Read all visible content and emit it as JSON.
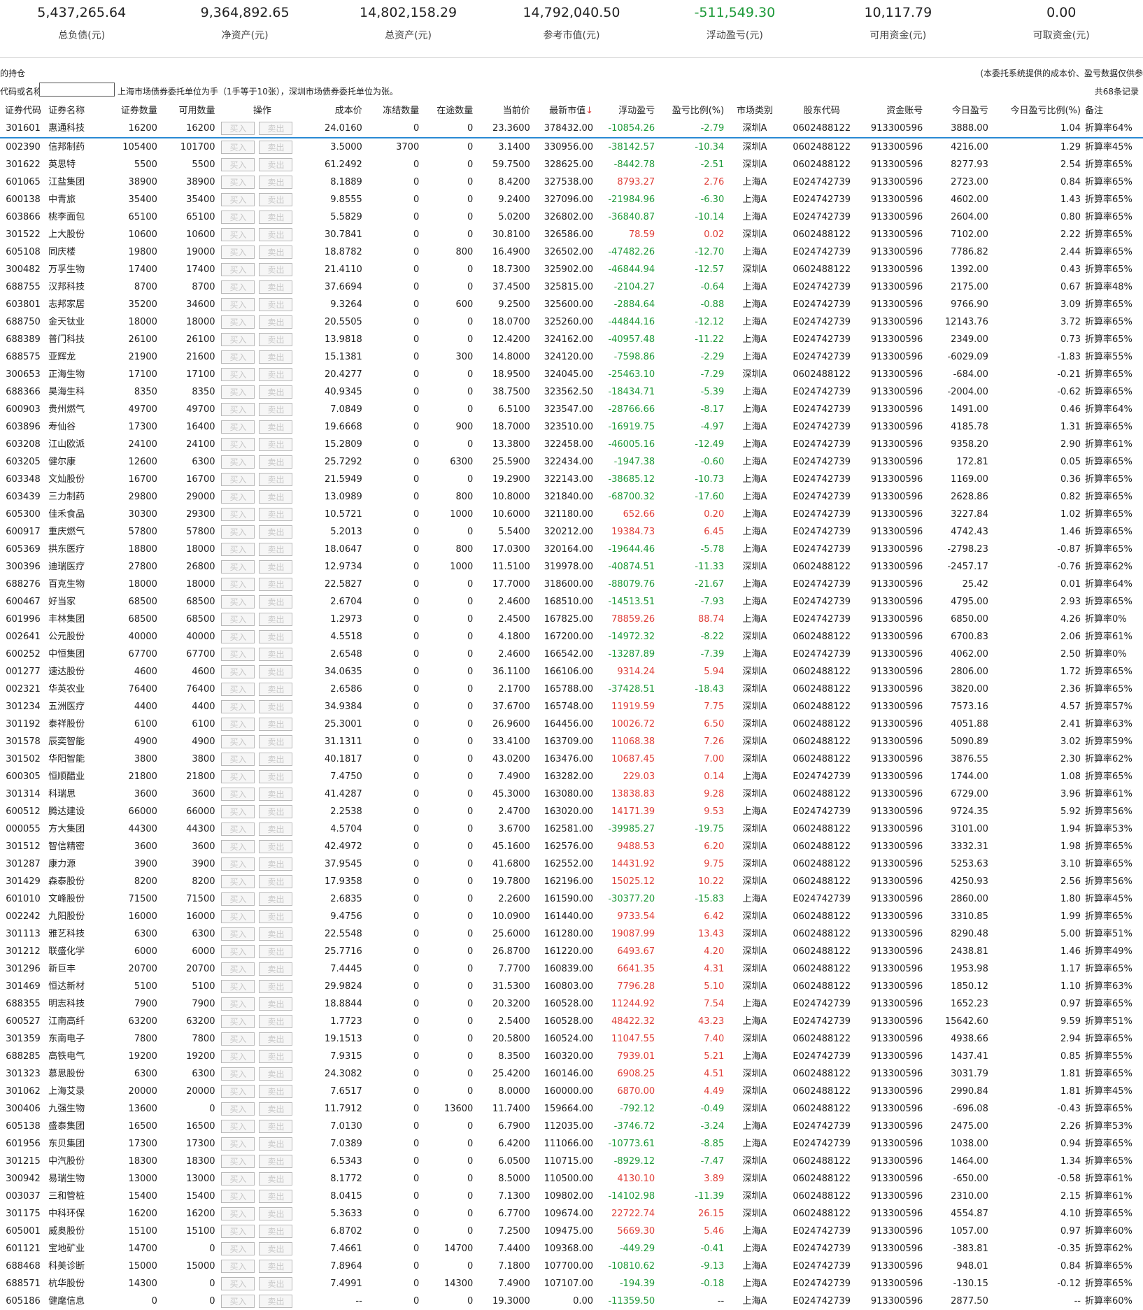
{
  "summary": [
    {
      "value": "5,437,265.64",
      "label": "总负债(元)"
    },
    {
      "value": "9,364,892.65",
      "label": "净资产(元)"
    },
    {
      "value": "14,802,158.29",
      "label": "总资产(元)"
    },
    {
      "value": "14,792,040.50",
      "label": "参考市值(元)"
    },
    {
      "value": "-511,549.30",
      "label": "浮动盈亏(元)"
    },
    {
      "value": "10,117.79",
      "label": "可用资金(元)"
    },
    {
      "value": "0.00",
      "label": "可取资金(元)"
    }
  ],
  "info_bar": {
    "left_text": "的持仓",
    "right_text": "(本委托系统提供的成本价、盈亏数据仅供参"
  },
  "search": {
    "label": "代码或名称",
    "value": "",
    "hint": "上海市场债券委托单位为手（1手等于10张），深圳市场债券委托单位为张。",
    "record_count": "共68条记录"
  },
  "buttons": {
    "buy": "买入",
    "sell": "卖出"
  },
  "columns": [
    "证券代码",
    "证券名称",
    "证券数量",
    "可用数量",
    "操作",
    "成本价",
    "冻结数量",
    "在途数量",
    "当前价",
    "最新市值",
    "浮动盈亏",
    "盈亏比例(%)",
    "市场类别",
    "股东代码",
    "资金账号",
    "今日盈亏",
    "今日盈亏比例(%)",
    "备注"
  ],
  "sort_arrow": "↓",
  "rows": [
    [
      "301601",
      "惠通科技",
      "16200",
      "16200",
      "24.0160",
      "0",
      "0",
      "23.3600",
      "378432.00",
      "-10854.26",
      "-2.79",
      "深圳A",
      "0602488122",
      "913300596",
      "3888.00",
      "1.04",
      "折算率64%"
    ],
    [
      "002390",
      "信邦制药",
      "105400",
      "101700",
      "3.5000",
      "3700",
      "0",
      "3.1400",
      "330956.00",
      "-38142.57",
      "-10.34",
      "深圳A",
      "0602488122",
      "913300596",
      "4216.00",
      "1.29",
      "折算率45%"
    ],
    [
      "301622",
      "英思特",
      "5500",
      "5500",
      "61.2492",
      "0",
      "0",
      "59.7500",
      "328625.00",
      "-8442.78",
      "-2.51",
      "深圳A",
      "0602488122",
      "913300596",
      "8277.93",
      "2.54",
      "折算率65%"
    ],
    [
      "601065",
      "江盐集团",
      "38900",
      "38900",
      "8.1889",
      "0",
      "0",
      "8.4200",
      "327538.00",
      "8793.27",
      "2.76",
      "上海A",
      "E024742739",
      "913300596",
      "2723.00",
      "0.84",
      "折算率65%"
    ],
    [
      "600138",
      "中青旅",
      "35400",
      "35400",
      "9.8555",
      "0",
      "0",
      "9.2400",
      "327096.00",
      "-21984.96",
      "-6.30",
      "上海A",
      "E024742739",
      "913300596",
      "4602.00",
      "1.43",
      "折算率65%"
    ],
    [
      "603866",
      "桃李面包",
      "65100",
      "65100",
      "5.5829",
      "0",
      "0",
      "5.0200",
      "326802.00",
      "-36840.87",
      "-10.14",
      "上海A",
      "E024742739",
      "913300596",
      "2604.00",
      "0.80",
      "折算率65%"
    ],
    [
      "301522",
      "上大股份",
      "10600",
      "10600",
      "30.7841",
      "0",
      "0",
      "30.8100",
      "326586.00",
      "78.59",
      "0.02",
      "深圳A",
      "0602488122",
      "913300596",
      "7102.00",
      "2.22",
      "折算率65%"
    ],
    [
      "605108",
      "同庆楼",
      "19800",
      "19000",
      "18.8782",
      "0",
      "800",
      "16.4900",
      "326502.00",
      "-47482.26",
      "-12.70",
      "上海A",
      "E024742739",
      "913300596",
      "7786.82",
      "2.44",
      "折算率65%"
    ],
    [
      "300482",
      "万孚生物",
      "17400",
      "17400",
      "21.4110",
      "0",
      "0",
      "18.7300",
      "325902.00",
      "-46844.94",
      "-12.57",
      "深圳A",
      "0602488122",
      "913300596",
      "1392.00",
      "0.43",
      "折算率65%"
    ],
    [
      "688755",
      "汉邦科技",
      "8700",
      "8700",
      "37.6694",
      "0",
      "0",
      "37.4500",
      "325815.00",
      "-2104.27",
      "-0.64",
      "上海A",
      "E024742739",
      "913300596",
      "2175.00",
      "0.67",
      "折算率48%"
    ],
    [
      "603801",
      "志邦家居",
      "35200",
      "34600",
      "9.3264",
      "0",
      "600",
      "9.2500",
      "325600.00",
      "-2884.64",
      "-0.88",
      "上海A",
      "E024742739",
      "913300596",
      "9766.90",
      "3.09",
      "折算率65%"
    ],
    [
      "688750",
      "金天钛业",
      "18000",
      "18000",
      "20.5505",
      "0",
      "0",
      "18.0700",
      "325260.00",
      "-44844.16",
      "-12.12",
      "上海A",
      "E024742739",
      "913300596",
      "12143.76",
      "3.72",
      "折算率65%"
    ],
    [
      "688389",
      "普门科技",
      "26100",
      "26100",
      "13.9818",
      "0",
      "0",
      "12.4200",
      "324162.00",
      "-40957.48",
      "-11.22",
      "上海A",
      "E024742739",
      "913300596",
      "2349.00",
      "0.73",
      "折算率65%"
    ],
    [
      "688575",
      "亚辉龙",
      "21900",
      "21600",
      "15.1381",
      "0",
      "300",
      "14.8000",
      "324120.00",
      "-7598.86",
      "-2.29",
      "上海A",
      "E024742739",
      "913300596",
      "-6029.09",
      "-1.83",
      "折算率55%"
    ],
    [
      "300653",
      "正海生物",
      "17100",
      "17100",
      "20.4277",
      "0",
      "0",
      "18.9500",
      "324045.00",
      "-25463.10",
      "-7.29",
      "深圳A",
      "0602488122",
      "913300596",
      "-684.00",
      "-0.21",
      "折算率65%"
    ],
    [
      "688366",
      "昊海生科",
      "8350",
      "8350",
      "40.9345",
      "0",
      "0",
      "38.7500",
      "323562.50",
      "-18434.71",
      "-5.39",
      "上海A",
      "E024742739",
      "913300596",
      "-2004.00",
      "-0.62",
      "折算率65%"
    ],
    [
      "600903",
      "贵州燃气",
      "49700",
      "49700",
      "7.0849",
      "0",
      "0",
      "6.5100",
      "323547.00",
      "-28766.66",
      "-8.17",
      "上海A",
      "E024742739",
      "913300596",
      "1491.00",
      "0.46",
      "折算率64%"
    ],
    [
      "603896",
      "寿仙谷",
      "17300",
      "16400",
      "19.6668",
      "0",
      "900",
      "18.7000",
      "323510.00",
      "-16919.75",
      "-4.97",
      "上海A",
      "E024742739",
      "913300596",
      "4185.78",
      "1.31",
      "折算率65%"
    ],
    [
      "603208",
      "江山欧派",
      "24100",
      "24100",
      "15.2809",
      "0",
      "0",
      "13.3800",
      "322458.00",
      "-46005.16",
      "-12.49",
      "上海A",
      "E024742739",
      "913300596",
      "9358.20",
      "2.90",
      "折算率61%"
    ],
    [
      "603205",
      "健尔康",
      "12600",
      "6300",
      "25.7292",
      "0",
      "6300",
      "25.5900",
      "322434.00",
      "-1947.38",
      "-0.60",
      "上海A",
      "E024742739",
      "913300596",
      "172.81",
      "0.05",
      "折算率65%"
    ],
    [
      "603348",
      "文灿股份",
      "16700",
      "16700",
      "21.5949",
      "0",
      "0",
      "19.2900",
      "322143.00",
      "-38685.12",
      "-10.73",
      "上海A",
      "E024742739",
      "913300596",
      "1169.00",
      "0.36",
      "折算率65%"
    ],
    [
      "603439",
      "三力制药",
      "29800",
      "29000",
      "13.0989",
      "0",
      "800",
      "10.8000",
      "321840.00",
      "-68700.32",
      "-17.60",
      "上海A",
      "E024742739",
      "913300596",
      "2628.86",
      "0.82",
      "折算率65%"
    ],
    [
      "605300",
      "佳禾食品",
      "30300",
      "29300",
      "10.5721",
      "0",
      "1000",
      "10.6000",
      "321180.00",
      "652.66",
      "0.20",
      "上海A",
      "E024742739",
      "913300596",
      "3227.84",
      "1.02",
      "折算率65%"
    ],
    [
      "600917",
      "重庆燃气",
      "57800",
      "57800",
      "5.2013",
      "0",
      "0",
      "5.5400",
      "320212.00",
      "19384.73",
      "6.45",
      "上海A",
      "E024742739",
      "913300596",
      "4742.43",
      "1.46",
      "折算率65%"
    ],
    [
      "605369",
      "拱东医疗",
      "18800",
      "18000",
      "18.0647",
      "0",
      "800",
      "17.0300",
      "320164.00",
      "-19644.46",
      "-5.78",
      "上海A",
      "E024742739",
      "913300596",
      "-2798.23",
      "-0.87",
      "折算率65%"
    ],
    [
      "300396",
      "迪瑞医疗",
      "27800",
      "26800",
      "12.9734",
      "0",
      "1000",
      "11.5100",
      "319978.00",
      "-40874.51",
      "-11.33",
      "深圳A",
      "0602488122",
      "913300596",
      "-2457.17",
      "-0.76",
      "折算率62%"
    ],
    [
      "688276",
      "百克生物",
      "18000",
      "18000",
      "22.5827",
      "0",
      "0",
      "17.7000",
      "318600.00",
      "-88079.76",
      "-21.67",
      "上海A",
      "E024742739",
      "913300596",
      "25.42",
      "0.01",
      "折算率64%"
    ],
    [
      "600467",
      "好当家",
      "68500",
      "68500",
      "2.6704",
      "0",
      "0",
      "2.4600",
      "168510.00",
      "-14513.51",
      "-7.93",
      "上海A",
      "E024742739",
      "913300596",
      "4795.00",
      "2.93",
      "折算率65%"
    ],
    [
      "601996",
      "丰林集团",
      "68500",
      "68500",
      "1.2973",
      "0",
      "0",
      "2.4500",
      "167825.00",
      "78859.26",
      "88.74",
      "上海A",
      "E024742739",
      "913300596",
      "6850.00",
      "4.26",
      "折算率0%"
    ],
    [
      "002641",
      "公元股份",
      "40000",
      "40000",
      "4.5518",
      "0",
      "0",
      "4.1800",
      "167200.00",
      "-14972.32",
      "-8.22",
      "深圳A",
      "0602488122",
      "913300596",
      "6700.83",
      "2.06",
      "折算率61%"
    ],
    [
      "600252",
      "中恒集团",
      "67700",
      "67700",
      "2.6548",
      "0",
      "0",
      "2.4600",
      "166542.00",
      "-13287.89",
      "-7.39",
      "上海A",
      "E024742739",
      "913300596",
      "4062.00",
      "2.50",
      "折算率0%"
    ],
    [
      "001277",
      "速达股份",
      "4600",
      "4600",
      "34.0635",
      "0",
      "0",
      "36.1100",
      "166106.00",
      "9314.24",
      "5.94",
      "深圳A",
      "0602488122",
      "913300596",
      "2806.00",
      "1.72",
      "折算率65%"
    ],
    [
      "002321",
      "华英农业",
      "76400",
      "76400",
      "2.6586",
      "0",
      "0",
      "2.1700",
      "165788.00",
      "-37428.51",
      "-18.43",
      "深圳A",
      "0602488122",
      "913300596",
      "3820.00",
      "2.36",
      "折算率65%"
    ],
    [
      "301234",
      "五洲医疗",
      "4400",
      "4400",
      "34.9384",
      "0",
      "0",
      "37.6700",
      "165748.00",
      "11919.59",
      "7.75",
      "深圳A",
      "0602488122",
      "913300596",
      "7573.16",
      "4.57",
      "折算率57%"
    ],
    [
      "301192",
      "泰祥股份",
      "6100",
      "6100",
      "25.3001",
      "0",
      "0",
      "26.9600",
      "164456.00",
      "10026.72",
      "6.50",
      "深圳A",
      "0602488122",
      "913300596",
      "4051.88",
      "2.41",
      "折算率63%"
    ],
    [
      "301578",
      "辰奕智能",
      "4900",
      "4900",
      "31.1311",
      "0",
      "0",
      "33.4100",
      "163709.00",
      "11068.38",
      "7.26",
      "深圳A",
      "0602488122",
      "913300596",
      "5090.89",
      "3.02",
      "折算率59%"
    ],
    [
      "301502",
      "华阳智能",
      "3800",
      "3800",
      "40.1817",
      "0",
      "0",
      "43.0200",
      "163476.00",
      "10687.45",
      "7.00",
      "深圳A",
      "0602488122",
      "913300596",
      "3876.55",
      "2.30",
      "折算率62%"
    ],
    [
      "600305",
      "恒顺醋业",
      "21800",
      "21800",
      "7.4750",
      "0",
      "0",
      "7.4900",
      "163282.00",
      "229.03",
      "0.14",
      "上海A",
      "E024742739",
      "913300596",
      "1744.00",
      "1.08",
      "折算率65%"
    ],
    [
      "301314",
      "科瑞思",
      "3600",
      "3600",
      "41.4287",
      "0",
      "0",
      "45.3000",
      "163080.00",
      "13838.83",
      "9.28",
      "深圳A",
      "0602488122",
      "913300596",
      "6729.00",
      "3.96",
      "折算率61%"
    ],
    [
      "600512",
      "腾达建设",
      "66000",
      "66000",
      "2.2538",
      "0",
      "0",
      "2.4700",
      "163020.00",
      "14171.39",
      "9.53",
      "上海A",
      "E024742739",
      "913300596",
      "9724.35",
      "5.92",
      "折算率56%"
    ],
    [
      "000055",
      "方大集团",
      "44300",
      "44300",
      "4.5704",
      "0",
      "0",
      "3.6700",
      "162581.00",
      "-39985.27",
      "-19.75",
      "深圳A",
      "0602488122",
      "913300596",
      "3101.00",
      "1.94",
      "折算率53%"
    ],
    [
      "301512",
      "智信精密",
      "3600",
      "3600",
      "42.4972",
      "0",
      "0",
      "45.1600",
      "162576.00",
      "9488.53",
      "6.20",
      "深圳A",
      "0602488122",
      "913300596",
      "3332.31",
      "1.98",
      "折算率65%"
    ],
    [
      "301287",
      "康力源",
      "3900",
      "3900",
      "37.9545",
      "0",
      "0",
      "41.6800",
      "162552.00",
      "14431.92",
      "9.75",
      "深圳A",
      "0602488122",
      "913300596",
      "5253.63",
      "3.10",
      "折算率65%"
    ],
    [
      "301429",
      "森泰股份",
      "8200",
      "8200",
      "17.9358",
      "0",
      "0",
      "19.7800",
      "162196.00",
      "15025.12",
      "10.22",
      "深圳A",
      "0602488122",
      "913300596",
      "4250.93",
      "2.56",
      "折算率56%"
    ],
    [
      "601010",
      "文峰股份",
      "71500",
      "71500",
      "2.6835",
      "0",
      "0",
      "2.2600",
      "161590.00",
      "-30377.20",
      "-15.83",
      "上海A",
      "E024742739",
      "913300596",
      "2860.00",
      "1.80",
      "折算率45%"
    ],
    [
      "002242",
      "九阳股份",
      "16000",
      "16000",
      "9.4756",
      "0",
      "0",
      "10.0900",
      "161440.00",
      "9733.54",
      "6.42",
      "深圳A",
      "0602488122",
      "913300596",
      "3310.85",
      "1.99",
      "折算率65%"
    ],
    [
      "301113",
      "雅艺科技",
      "6300",
      "6300",
      "22.5548",
      "0",
      "0",
      "25.6000",
      "161280.00",
      "19087.99",
      "13.43",
      "深圳A",
      "0602488122",
      "913300596",
      "8290.48",
      "5.00",
      "折算率51%"
    ],
    [
      "301212",
      "联盛化学",
      "6000",
      "6000",
      "25.7716",
      "0",
      "0",
      "26.8700",
      "161220.00",
      "6493.67",
      "4.20",
      "深圳A",
      "0602488122",
      "913300596",
      "2438.81",
      "1.46",
      "折算率49%"
    ],
    [
      "301296",
      "新巨丰",
      "20700",
      "20700",
      "7.4445",
      "0",
      "0",
      "7.7700",
      "160839.00",
      "6641.35",
      "4.31",
      "深圳A",
      "0602488122",
      "913300596",
      "1953.98",
      "1.17",
      "折算率65%"
    ],
    [
      "301469",
      "恒达新材",
      "5100",
      "5100",
      "29.9824",
      "0",
      "0",
      "31.5300",
      "160803.00",
      "7796.28",
      "5.10",
      "深圳A",
      "0602488122",
      "913300596",
      "1850.12",
      "1.10",
      "折算率63%"
    ],
    [
      "688355",
      "明志科技",
      "7900",
      "7900",
      "18.8844",
      "0",
      "0",
      "20.3200",
      "160528.00",
      "11244.92",
      "7.54",
      "上海A",
      "E024742739",
      "913300596",
      "1652.23",
      "0.97",
      "折算率65%"
    ],
    [
      "600527",
      "江南高纤",
      "63200",
      "63200",
      "1.7723",
      "0",
      "0",
      "2.5400",
      "160528.00",
      "48422.32",
      "43.23",
      "上海A",
      "E024742739",
      "913300596",
      "15642.60",
      "9.59",
      "折算率51%"
    ],
    [
      "301359",
      "东南电子",
      "7800",
      "7800",
      "19.1513",
      "0",
      "0",
      "20.5800",
      "160524.00",
      "11047.55",
      "7.40",
      "深圳A",
      "0602488122",
      "913300596",
      "4938.66",
      "2.94",
      "折算率65%"
    ],
    [
      "688285",
      "高铁电气",
      "19200",
      "19200",
      "7.9315",
      "0",
      "0",
      "8.3500",
      "160320.00",
      "7939.01",
      "5.21",
      "上海A",
      "E024742739",
      "913300596",
      "1437.41",
      "0.85",
      "折算率55%"
    ],
    [
      "301323",
      "慕思股份",
      "6300",
      "6300",
      "24.3082",
      "0",
      "0",
      "25.4200",
      "160146.00",
      "6908.25",
      "4.51",
      "深圳A",
      "0602488122",
      "913300596",
      "3031.79",
      "1.81",
      "折算率65%"
    ],
    [
      "301062",
      "上海艾录",
      "20000",
      "20000",
      "7.6517",
      "0",
      "0",
      "8.0000",
      "160000.00",
      "6870.00",
      "4.49",
      "深圳A",
      "0602488122",
      "913300596",
      "2990.84",
      "1.81",
      "折算率45%"
    ],
    [
      "300406",
      "九强生物",
      "13600",
      "0",
      "11.7912",
      "0",
      "13600",
      "11.7400",
      "159664.00",
      "-792.12",
      "-0.49",
      "深圳A",
      "0602488122",
      "913300596",
      "-696.08",
      "-0.43",
      "折算率65%"
    ],
    [
      "605138",
      "盛泰集团",
      "16500",
      "16500",
      "7.0130",
      "0",
      "0",
      "6.7900",
      "112035.00",
      "-3746.72",
      "-3.24",
      "上海A",
      "E024742739",
      "913300596",
      "2475.00",
      "2.26",
      "折算率53%"
    ],
    [
      "601956",
      "东贝集团",
      "17300",
      "17300",
      "7.0389",
      "0",
      "0",
      "6.4200",
      "111066.00",
      "-10773.61",
      "-8.85",
      "上海A",
      "E024742739",
      "913300596",
      "1038.00",
      "0.94",
      "折算率65%"
    ],
    [
      "301215",
      "中汽股份",
      "18300",
      "18300",
      "6.5343",
      "0",
      "0",
      "6.0500",
      "110715.00",
      "-8929.12",
      "-7.47",
      "深圳A",
      "0602488122",
      "913300596",
      "1464.00",
      "1.34",
      "折算率65%"
    ],
    [
      "300942",
      "易瑞生物",
      "13000",
      "13000",
      "8.1772",
      "0",
      "0",
      "8.5000",
      "110500.00",
      "4130.10",
      "3.89",
      "深圳A",
      "0602488122",
      "913300596",
      "-650.00",
      "-0.58",
      "折算率61%"
    ],
    [
      "003037",
      "三和管桩",
      "15400",
      "15400",
      "8.0415",
      "0",
      "0",
      "7.1300",
      "109802.00",
      "-14102.98",
      "-11.39",
      "深圳A",
      "0602488122",
      "913300596",
      "2310.00",
      "2.15",
      "折算率61%"
    ],
    [
      "301175",
      "中科环保",
      "16200",
      "16200",
      "5.3633",
      "0",
      "0",
      "6.7700",
      "109674.00",
      "22722.74",
      "26.15",
      "深圳A",
      "0602488122",
      "913300596",
      "4554.87",
      "4.10",
      "折算率65%"
    ],
    [
      "605001",
      "威奥股份",
      "15100",
      "15100",
      "6.8702",
      "0",
      "0",
      "7.2500",
      "109475.00",
      "5669.30",
      "5.46",
      "上海A",
      "E024742739",
      "913300596",
      "1057.00",
      "0.97",
      "折算率60%"
    ],
    [
      "601121",
      "宝地矿业",
      "14700",
      "0",
      "7.4661",
      "0",
      "14700",
      "7.4400",
      "109368.00",
      "-449.29",
      "-0.41",
      "上海A",
      "E024742739",
      "913300596",
      "-383.81",
      "-0.35",
      "折算率62%"
    ],
    [
      "688468",
      "科美诊断",
      "15000",
      "15000",
      "7.8964",
      "0",
      "0",
      "7.1800",
      "107700.00",
      "-10810.62",
      "-9.13",
      "上海A",
      "E024742739",
      "913300596",
      "948.01",
      "0.84",
      "折算率65%"
    ],
    [
      "688571",
      "杭华股份",
      "14300",
      "0",
      "7.4991",
      "0",
      "14300",
      "7.4900",
      "107107.00",
      "-194.39",
      "-0.18",
      "上海A",
      "E024742739",
      "913300596",
      "-130.15",
      "-0.12",
      "折算率65%"
    ],
    [
      "605186",
      "健麾信息",
      "0",
      "0",
      "--",
      "0",
      "0",
      "19.3000",
      "0.00",
      "-11359.50",
      "--",
      "上海A",
      "E024742739",
      "913300596",
      "2877.50",
      "--",
      "折算率60%"
    ]
  ]
}
